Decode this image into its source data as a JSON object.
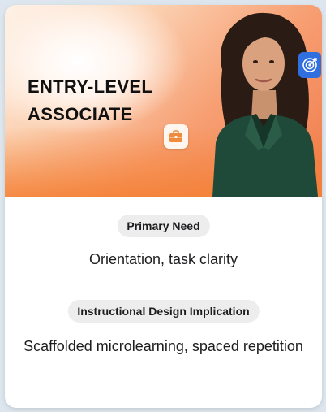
{
  "card": {
    "title": "ENTRY-LEVEL ASSOCIATE",
    "badge_icon": "briefcase-icon",
    "corner_icon": "target-icon",
    "accent_color": "#f5823f",
    "badge_color": "#2f6fe0",
    "sections": [
      {
        "label": "Primary Need",
        "value": "Orientation, task clarity"
      },
      {
        "label": "Instructional Design Implication",
        "value": "Scaffolded microlearning, spaced repetition"
      }
    ]
  }
}
